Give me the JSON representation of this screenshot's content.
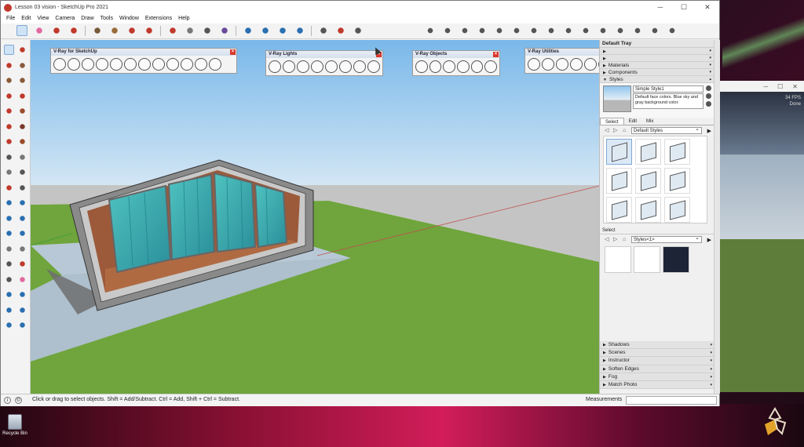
{
  "colors": {
    "accent": "#7fa8d4",
    "sky": "#8cc4ec",
    "grass": "#6fa53c",
    "close": "#d9362a"
  },
  "window": {
    "title": "Lesson 03 vision - SketchUp Pro 2021",
    "controls": [
      "─",
      "☐",
      "✕"
    ]
  },
  "menu": [
    "File",
    "Edit",
    "View",
    "Camera",
    "Draw",
    "Tools",
    "Window",
    "Extensions",
    "Help"
  ],
  "floating_toolbars": [
    {
      "title": "V-Ray for SketchUp",
      "icon_count": 12
    },
    {
      "title": "V-Ray Lights",
      "icon_count": 8
    },
    {
      "title": "V-Ray Objects",
      "icon_count": 6
    },
    {
      "title": "V-Ray Utilities",
      "icon_count": 7
    }
  ],
  "tray": {
    "title": "Default Tray",
    "panels_top": [
      "Materials",
      "Components",
      "Styles"
    ],
    "style": {
      "name": "Simple Style1",
      "description": "Default face colors. Blue sky and gray background color."
    },
    "tabs": [
      "Select",
      "Edit",
      "Mix"
    ],
    "active_tab": "Select",
    "library": "Default Styles",
    "lower_label": "Select",
    "lower_library": "Styles<1>",
    "panels_bottom": [
      "Shadows",
      "Scenes",
      "Instructor",
      "Soften Edges",
      "Fog",
      "Match Photo"
    ]
  },
  "status": {
    "hint": "Click or drag to select objects. Shift = Add/Subtract. Ctrl = Add, Shift + Ctrl = Subtract.",
    "measurements_label": "Measurements",
    "measurements_value": ""
  },
  "bg_window": {
    "fps": "34 FPS",
    "state": "Done"
  },
  "desktop": {
    "recycle_bin": "Recycle Bin"
  },
  "icons": {
    "toolbar": [
      "select-icon",
      "eraser-icon",
      "pencil-icon",
      "arc-icon",
      "shape-icon",
      "push-pull-icon",
      "move-icon",
      "rotate-icon",
      "scale-icon",
      "tape-icon",
      "text-icon",
      "paint-icon",
      "orbit-icon",
      "pan-icon",
      "zoom-icon",
      "zoom-extents-icon",
      "3d-warehouse-icon",
      "section-icon",
      "camera-views-icon"
    ],
    "tray_side": [
      "detail-icon",
      "create-style-icon",
      "update-style-icon"
    ]
  }
}
